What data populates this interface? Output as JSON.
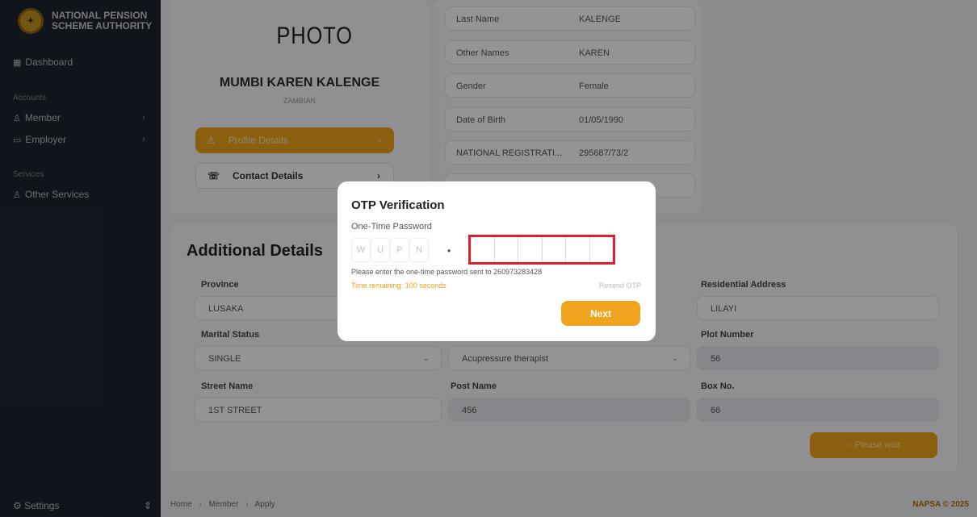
{
  "sidebar": {
    "org_line1": "NATIONAL PENSION",
    "org_line2": "SCHEME AUTHORITY",
    "dashboard": "Dashboard",
    "accounts_section": "Accounts",
    "member": "Member",
    "employer": "Employer",
    "services_section": "Services",
    "other_services": "Other Services",
    "settings": "Settings"
  },
  "profile": {
    "photo_label": "PHOTO",
    "full_name": "MUMBI KAREN KALENGE",
    "nationality": "ZAMBIAN",
    "profile_details_btn": "Profile Details",
    "contact_details_btn": "Contact Details"
  },
  "info": {
    "rows": [
      {
        "label": "Last Name",
        "value": "KALENGE"
      },
      {
        "label": "Other Names",
        "value": "KAREN"
      },
      {
        "label": "Gender",
        "value": "Female"
      },
      {
        "label": "Date of Birth",
        "value": "01/05/1990"
      },
      {
        "label": "NATIONAL REGISTRATI...",
        "value": "295687/73/2"
      }
    ]
  },
  "details": {
    "title": "Additional Details",
    "province_label": "Province",
    "province_value": "LUSAKA",
    "marital_label": "Marital Status",
    "marital_value": "SINGLE",
    "occupation_value": "Acupressure therapist",
    "street_label": "Street Name",
    "street_value": "1ST STREET",
    "post_label": "Post Name",
    "post_value": "456",
    "residential_label": "Residential Address",
    "residential_value": "LILAYI",
    "plot_label": "Plot Number",
    "plot_value": "56",
    "box_label": "Box No.",
    "box_value": "66",
    "wait_btn": "Please wait"
  },
  "footer": {
    "crumb_home": "Home",
    "crumb_member": "Member",
    "crumb_apply": "Apply",
    "copyright": "NAPSA © 2025"
  },
  "modal": {
    "title": "OTP Verification",
    "subtitle": "One-Time Password",
    "prefix": [
      "W",
      "U",
      "P",
      "N"
    ],
    "separator": "•",
    "hint": "Please enter the one-time password sent to 260973283428",
    "timer": "Time remaining: 100 seconds",
    "resend": "Resend OTP",
    "next": "Next"
  },
  "colors": {
    "accent": "#f0a41d",
    "sidebar_bg": "#1f2430",
    "highlight": "#e11d2b"
  }
}
